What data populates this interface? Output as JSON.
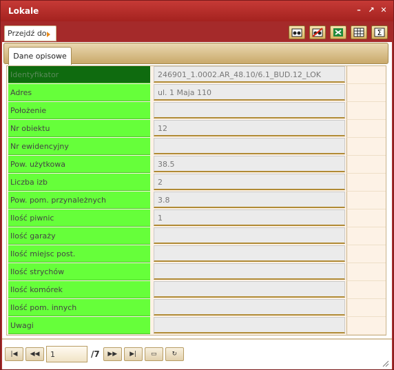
{
  "window": {
    "title": "Lokale"
  },
  "toolbar": {
    "goto_label": "Przejdź do"
  },
  "tabs": [
    {
      "label": "Dane opisowe"
    }
  ],
  "fields": [
    {
      "label": "Identyfikator",
      "value": "246901_1.0002.AR_48.10/6.1_BUD.12_LOK"
    },
    {
      "label": "Adres",
      "value": "ul. 1 Maja 110"
    },
    {
      "label": "Położenie",
      "value": ""
    },
    {
      "label": "Nr obiektu",
      "value": "12"
    },
    {
      "label": "Nr ewidencyjny",
      "value": ""
    },
    {
      "label": "Pow. użytkowa",
      "value": "38.5"
    },
    {
      "label": "Liczba izb",
      "value": "2"
    },
    {
      "label": "Pow. pom. przynależnych",
      "value": "3.8"
    },
    {
      "label": "Ilość piwnic",
      "value": "1"
    },
    {
      "label": "Ilość garaży",
      "value": ""
    },
    {
      "label": "Ilość miejsc post.",
      "value": ""
    },
    {
      "label": "Ilość strychów",
      "value": ""
    },
    {
      "label": "Ilość komórek",
      "value": ""
    },
    {
      "label": "Ilość pom. innych",
      "value": ""
    },
    {
      "label": "Uwagi",
      "value": ""
    }
  ],
  "pager": {
    "current": "1",
    "total": "/7"
  }
}
